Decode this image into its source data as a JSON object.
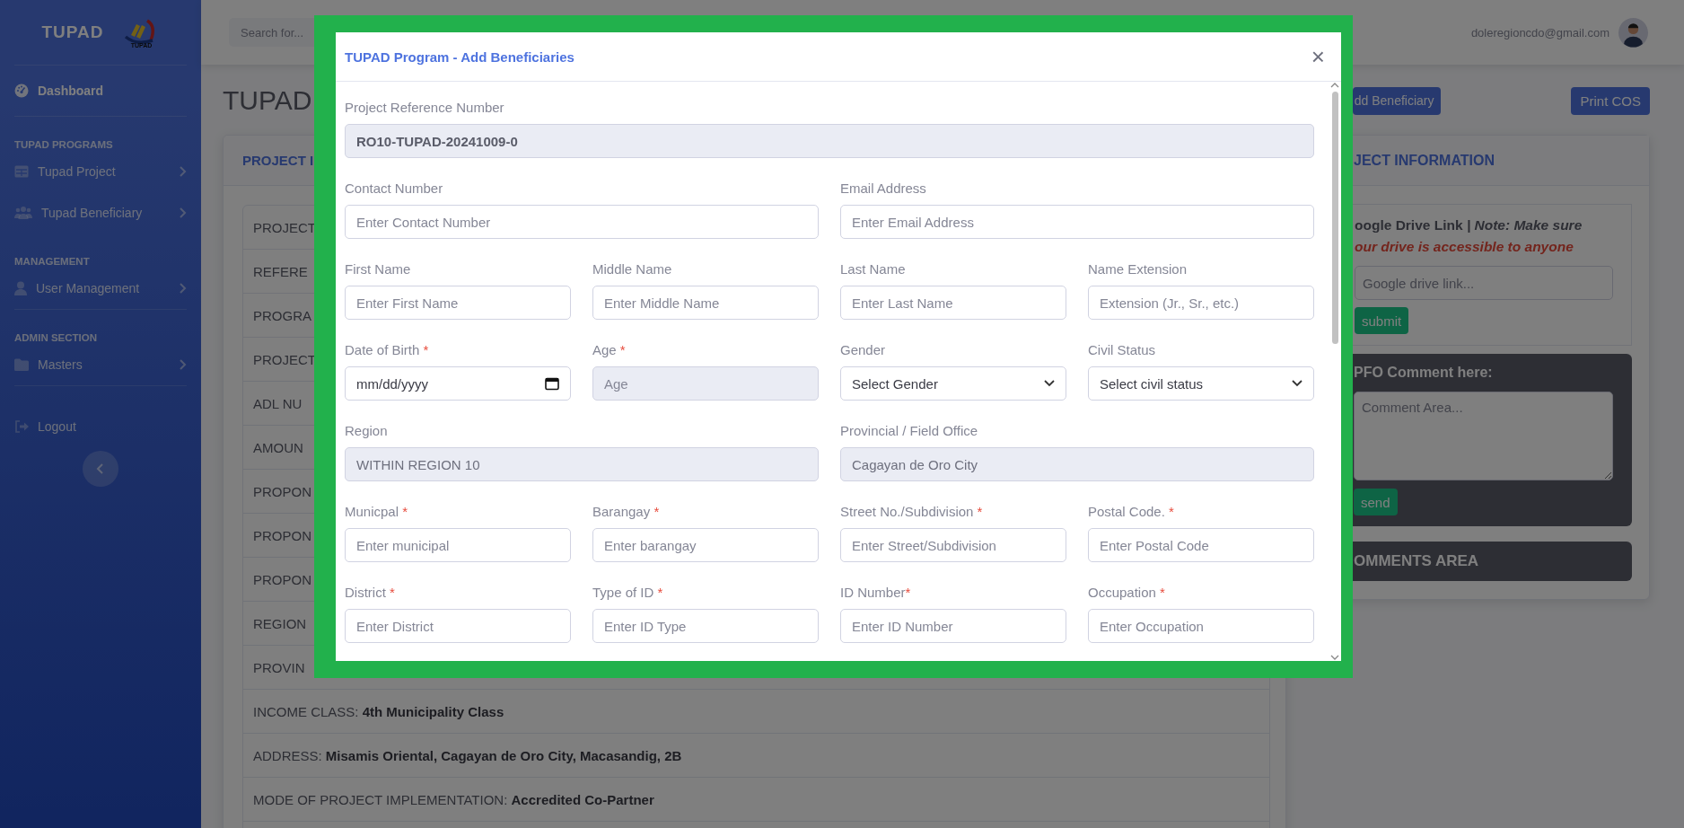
{
  "sidebar": {
    "brand": "TUPAD",
    "logo_text": "TUPAD",
    "items": [
      {
        "kind": "link",
        "label": "Dashboard",
        "active": true,
        "submenu": false
      },
      {
        "kind": "divider"
      },
      {
        "kind": "heading",
        "label": "TUPAD PROGRAMS"
      },
      {
        "kind": "link",
        "label": "Tupad Project",
        "active": false,
        "submenu": true
      },
      {
        "kind": "link",
        "label": "Tupad Beneficiary",
        "active": false,
        "submenu": true
      },
      {
        "kind": "heading",
        "label": "MANAGEMENT"
      },
      {
        "kind": "link",
        "label": "User Management",
        "active": false,
        "submenu": true
      },
      {
        "kind": "divider"
      },
      {
        "kind": "heading",
        "label": "ADMIN SECTION"
      },
      {
        "kind": "link",
        "label": "Masters",
        "active": false,
        "submenu": true
      },
      {
        "kind": "divider"
      },
      {
        "kind": "link",
        "label": "Logout",
        "active": false,
        "submenu": false
      }
    ]
  },
  "topbar": {
    "search": {
      "placeholder": "Search for..."
    },
    "user": "doleregioncdo@gmail.com"
  },
  "page": {
    "title": "TUPAD",
    "buttons": [
      "dd Beneficiary",
      "Print COS"
    ]
  },
  "project_card": {
    "title": "PROJECT I",
    "rows": [
      "PROJECT",
      "REFERE",
      "PROGRA",
      "PROJECT",
      "ADL NU",
      "AMOUN",
      "PROPON",
      "PROPON",
      "PROPON",
      "REGION",
      "PROVIN",
      "INCOME CLASS: **4th Municipality Class**",
      "ADDRESS: **Misamis Oriental, Cagayan de Oro City, Macasandig, 2B**",
      "MODE OF PROJECT IMPLEMENTATION: **Accredited Co-Partner**"
    ]
  },
  "info_card": {
    "title": "JECT INFORMATION",
    "drive": {
      "heading": "oogle Drive Link *| Note: Make sure*",
      "note": "our drive is accessible to anyone",
      "placeholder": "Google drive link...",
      "button": "submit"
    },
    "comment": {
      "title": "PFO Comment here:",
      "placeholder": "Comment Area...",
      "button": "send"
    },
    "comments_title": "OMMENTS AREA"
  },
  "modal": {
    "title": "TUPAD Program - Add Beneficiaries",
    "close": "×",
    "rows": [
      [
        {
          "label": "Project Reference Number",
          "kind": "reference",
          "value": "RO10-TUPAD-20241009-0"
        }
      ],
      [
        {
          "label": "Contact Number",
          "kind": "input",
          "placeholder": "Enter Contact Number"
        },
        {
          "label": "Email Address",
          "kind": "input",
          "placeholder": "Enter Email Address"
        }
      ],
      [
        {
          "label": "First Name",
          "kind": "input",
          "placeholder": "Enter First Name"
        },
        {
          "label": "Middle Name",
          "kind": "input",
          "placeholder": "Enter Middle Name"
        },
        {
          "label": "Last Name",
          "kind": "input",
          "placeholder": "Enter Last Name"
        },
        {
          "label": "Name Extension",
          "kind": "input",
          "placeholder": "Extension (Jr., Sr., etc.)"
        }
      ],
      [
        {
          "label": "Date of Birth ",
          "required_mark": "*",
          "kind": "date",
          "placeholder": "mm/dd/yyyy"
        },
        {
          "label": "Age ",
          "required_mark": "*",
          "kind": "readonly",
          "placeholder": "Age"
        },
        {
          "label": "Gender",
          "kind": "select",
          "placeholder": "Select Gender"
        },
        {
          "label": "Civil Status",
          "kind": "select",
          "placeholder": "Select civil status"
        }
      ],
      [
        {
          "label": "Region",
          "kind": "readonly",
          "value": "WITHIN REGION 10"
        },
        {
          "label": "Provincial / Field Office",
          "kind": "readonly",
          "value": "Cagayan de Oro City"
        }
      ],
      [
        {
          "label": "Municpal ",
          "required_mark": "*",
          "kind": "input",
          "placeholder": "Enter municipal"
        },
        {
          "label": "Barangay ",
          "required_mark": "*",
          "kind": "input",
          "placeholder": "Enter barangay"
        },
        {
          "label": "Street No./Subdivision ",
          "required_mark": "*",
          "kind": "input",
          "placeholder": "Enter Street/Subdivision"
        },
        {
          "label": "Postal Code. ",
          "required_mark": "*",
          "kind": "input",
          "placeholder": "Enter Postal Code"
        }
      ],
      [
        {
          "label": "District ",
          "required_mark": "*",
          "kind": "input",
          "placeholder": "Enter District"
        },
        {
          "label": "Type of ID ",
          "required_mark": "*",
          "kind": "input",
          "placeholder": "Enter ID Type"
        },
        {
          "label": "ID Number",
          "required_mark": "*",
          "kind": "input",
          "placeholder": "Enter ID Number"
        },
        {
          "label": "Occupation ",
          "required_mark": "*",
          "kind": "input",
          "placeholder": "Enter Occupation"
        }
      ]
    ]
  }
}
